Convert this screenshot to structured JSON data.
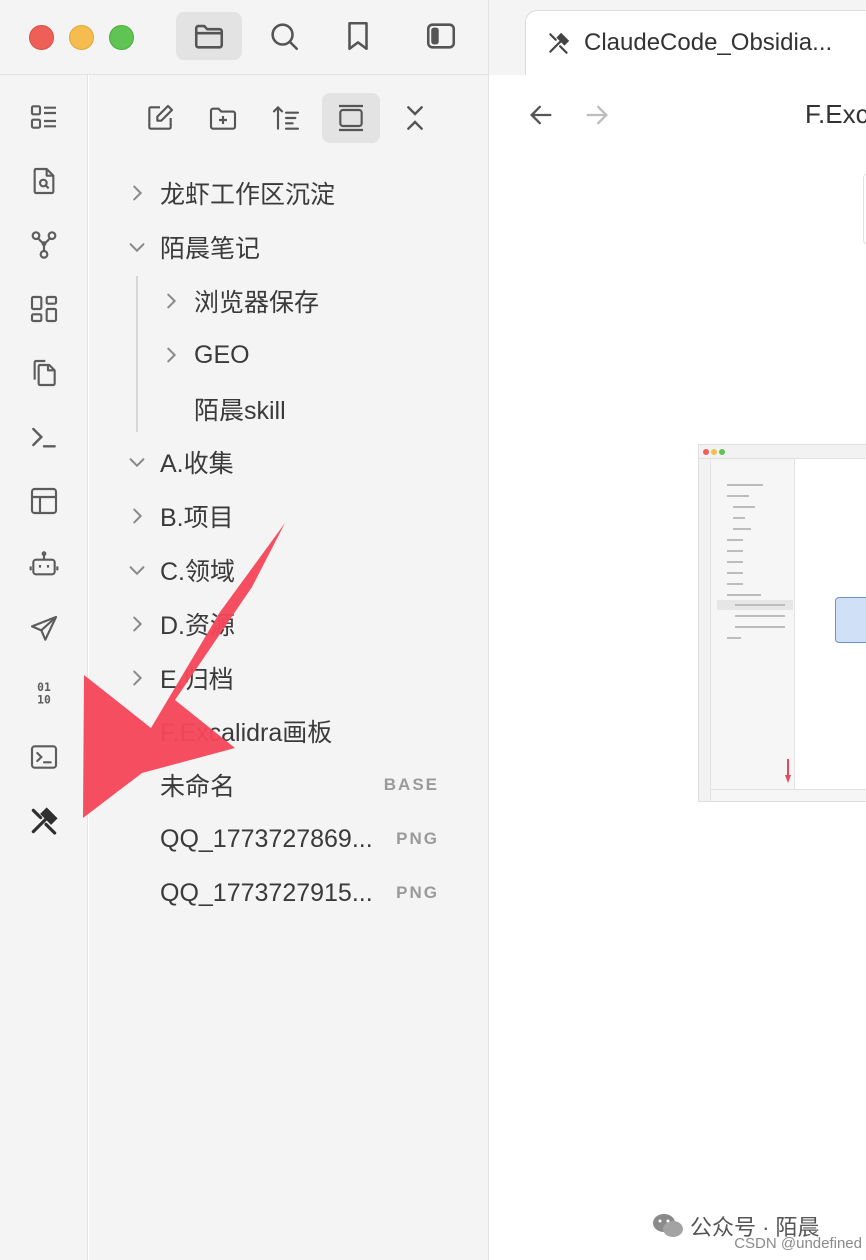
{
  "window": {
    "active_tab_title": "ClaudeCode_Obsidia...",
    "document_title": "F.Exc"
  },
  "top_toolbar": {
    "icons": [
      "folder-icon",
      "search-icon",
      "bookmark-icon",
      "sidebar-toggle-icon"
    ]
  },
  "ribbon": {
    "icons": [
      "quick-switcher-icon",
      "file-search-icon",
      "graph-view-icon",
      "canvas-icon",
      "copy-icon",
      "terminal-prompt-icon",
      "layout-icon",
      "bot-icon",
      "send-icon",
      "binary-icon",
      "terminal-window-icon",
      "excalidraw-icon"
    ]
  },
  "explorer": {
    "toolbar_icons": [
      "new-note-icon",
      "new-folder-icon",
      "sort-icon",
      "collapse-view-icon",
      "collapse-all-icon"
    ],
    "tree": [
      {
        "label": "龙虾工作区沉淀",
        "type": "folder",
        "expanded": false
      },
      {
        "label": "陌晨笔记",
        "type": "folder",
        "expanded": true
      },
      {
        "label": "浏览器保存",
        "type": "folder",
        "expanded": false
      },
      {
        "label": "GEO",
        "type": "folder",
        "expanded": false
      },
      {
        "label": "陌晨skill",
        "type": "file"
      },
      {
        "label": "A.收集",
        "type": "folder",
        "expanded": true
      },
      {
        "label": "B.项目",
        "type": "folder",
        "expanded": false
      },
      {
        "label": "C.领域",
        "type": "folder",
        "expanded": true
      },
      {
        "label": "D.资源",
        "type": "folder",
        "expanded": false
      },
      {
        "label": "E.归档",
        "type": "folder",
        "expanded": false
      },
      {
        "label": "F.Excalidra画板",
        "type": "folder"
      },
      {
        "label": "未命名",
        "type": "file",
        "ext": "BASE"
      },
      {
        "label": "QQ_1773727869...",
        "type": "file",
        "ext": "PNG"
      },
      {
        "label": "QQ_1773727915...",
        "type": "file",
        "ext": "PNG"
      }
    ]
  },
  "watermark": {
    "main": "公众号 · 陌晨",
    "csdn": "CSDN @undefined"
  },
  "colors": {
    "annotation_arrow": "#f4475a",
    "traffic_red": "#ee5f57",
    "traffic_yellow": "#f5bd4f",
    "traffic_green": "#5fc454"
  }
}
